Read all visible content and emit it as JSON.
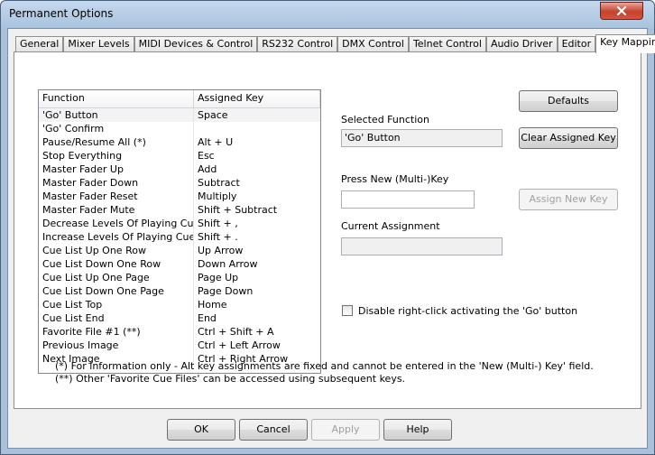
{
  "window": {
    "title": "Permanent Options"
  },
  "tabs": [
    {
      "label": "General"
    },
    {
      "label": "Mixer Levels"
    },
    {
      "label": "MIDI Devices & Control"
    },
    {
      "label": "RS232 Control"
    },
    {
      "label": "DMX Control"
    },
    {
      "label": "Telnet Control"
    },
    {
      "label": "Audio Driver"
    },
    {
      "label": "Editor"
    },
    {
      "label": "Key Mapping"
    }
  ],
  "active_tab": "Key Mapping",
  "key_table": {
    "headers": {
      "function": "Function",
      "assigned_key": "Assigned Key"
    },
    "rows": [
      {
        "function": "'Go' Button",
        "key": "Space"
      },
      {
        "function": "'Go' Confirm",
        "key": ""
      },
      {
        "function": "Pause/Resume All (*)",
        "key": "Alt + U"
      },
      {
        "function": "Stop Everything",
        "key": "Esc"
      },
      {
        "function": "Master Fader Up",
        "key": "Add"
      },
      {
        "function": "Master Fader Down",
        "key": "Subtract"
      },
      {
        "function": "Master Fader Reset",
        "key": "Multiply"
      },
      {
        "function": "Master Fader Mute",
        "key": "Shift + Subtract"
      },
      {
        "function": "Decrease Levels Of Playing Cues",
        "key": "Shift + ,"
      },
      {
        "function": "Increase Levels Of Playing Cues",
        "key": "Shift + ."
      },
      {
        "function": "Cue List Up One Row",
        "key": "Up Arrow"
      },
      {
        "function": "Cue List Down One Row",
        "key": "Down Arrow"
      },
      {
        "function": "Cue List Up One Page",
        "key": "Page Up"
      },
      {
        "function": "Cue List Down One Page",
        "key": "Page Down"
      },
      {
        "function": "Cue List Top",
        "key": "Home"
      },
      {
        "function": "Cue List End",
        "key": "End"
      },
      {
        "function": "Favorite File #1 (**)",
        "key": "Ctrl + Shift + A"
      },
      {
        "function": "Previous Image",
        "key": "Ctrl + Left Arrow"
      },
      {
        "function": "Next Image",
        "key": "Ctrl + Right Arrow"
      }
    ]
  },
  "right_panel": {
    "defaults_label": "Defaults",
    "selected_function_label": "Selected Function",
    "selected_function_value": "'Go' Button",
    "clear_label": "Clear Assigned Key",
    "press_new_label": "Press New (Multi-)Key",
    "press_new_value": "",
    "assign_label": "Assign New Key",
    "current_assignment_label": "Current Assignment",
    "current_assignment_value": "",
    "disable_checkbox_label": "Disable right-click activating the 'Go' button",
    "disable_checked": false
  },
  "footnotes": {
    "note1": "(*) For information only - Alt key assignments are fixed and cannot be entered in the 'New (Multi-) Key' field.",
    "note2": "(**) Other 'Favorite Cue Files' can be accessed using subsequent keys."
  },
  "buttons": {
    "ok": "OK",
    "cancel": "Cancel",
    "apply": "Apply",
    "help": "Help"
  },
  "icons": {
    "close": "close-icon"
  }
}
